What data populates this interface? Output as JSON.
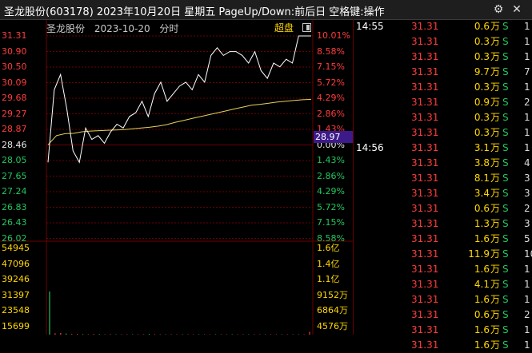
{
  "header": {
    "title": "圣龙股份(603178)  2023年10月20日  星期五  PageUp/Down:前后日  空格键:操作",
    "settings_icon": "gear-icon",
    "close_icon": "close-icon"
  },
  "chart": {
    "stock_name": "圣龙股份",
    "date_label": "2023-10-20",
    "period_label": "分时",
    "super_label": "超盘",
    "current_price_label": "28.97",
    "price_axis": [
      "31.31",
      "30.90",
      "30.50",
      "30.09",
      "29.68",
      "29.27",
      "28.87",
      "28.46",
      "28.05",
      "27.65",
      "27.24",
      "26.83",
      "26.43",
      "26.02"
    ],
    "pct_axis": [
      "10.01%",
      "8.58%",
      "7.15%",
      "5.72%",
      "4.29%",
      "2.86%",
      "1.43%",
      "0.00%",
      "1.43%",
      "2.86%",
      "4.29%",
      "5.72%",
      "7.15%",
      "8.58%"
    ],
    "volume_axis": [
      "54945",
      "47096",
      "39246",
      "31397",
      "23548",
      "15699"
    ],
    "amount_axis": [
      "1.6亿",
      "1.4亿",
      "1.1亿",
      "9152万",
      "6864万",
      "4576万"
    ],
    "colors": {
      "up": "#ff3b3b",
      "down": "#22c55e",
      "price_line": "#ffffff",
      "avg_line": "#e6d15a",
      "grid": "#6b0000"
    }
  },
  "ticks": {
    "rows": [
      {
        "time": "14:55",
        "price": "31.31",
        "vol": "0.6",
        "unit": "万",
        "side": "S",
        "extra": "1"
      },
      {
        "time": "",
        "price": "31.31",
        "vol": "0.3",
        "unit": "万",
        "side": "S",
        "extra": "1"
      },
      {
        "time": "",
        "price": "31.31",
        "vol": "0.3",
        "unit": "万",
        "side": "S",
        "extra": "1"
      },
      {
        "time": "",
        "price": "31.31",
        "vol": "9.7",
        "unit": "万",
        "side": "S",
        "extra": "7"
      },
      {
        "time": "",
        "price": "31.31",
        "vol": "0.3",
        "unit": "万",
        "side": "S",
        "extra": "1"
      },
      {
        "time": "",
        "price": "31.31",
        "vol": "0.9",
        "unit": "万",
        "side": "S",
        "extra": "2"
      },
      {
        "time": "",
        "price": "31.31",
        "vol": "0.3",
        "unit": "万",
        "side": "S",
        "extra": "1"
      },
      {
        "time": "",
        "price": "31.31",
        "vol": "0.3",
        "unit": "万",
        "side": "S",
        "extra": "1"
      },
      {
        "time": "14:56",
        "price": "31.31",
        "vol": "3.1",
        "unit": "万",
        "side": "S",
        "extra": "1"
      },
      {
        "time": "",
        "price": "31.31",
        "vol": "3.8",
        "unit": "万",
        "side": "S",
        "extra": "4"
      },
      {
        "time": "",
        "price": "31.31",
        "vol": "8.1",
        "unit": "万",
        "side": "S",
        "extra": "3"
      },
      {
        "time": "",
        "price": "31.31",
        "vol": "3.4",
        "unit": "万",
        "side": "S",
        "extra": "3"
      },
      {
        "time": "",
        "price": "31.31",
        "vol": "0.6",
        "unit": "万",
        "side": "S",
        "extra": "2"
      },
      {
        "time": "",
        "price": "31.31",
        "vol": "1.3",
        "unit": "万",
        "side": "S",
        "extra": "3"
      },
      {
        "time": "",
        "price": "31.31",
        "vol": "1.6",
        "unit": "万",
        "side": "S",
        "extra": "5"
      },
      {
        "time": "",
        "price": "31.31",
        "vol": "11.9",
        "unit": "万",
        "side": "S",
        "extra": "10"
      },
      {
        "time": "",
        "price": "31.31",
        "vol": "1.6",
        "unit": "万",
        "side": "S",
        "extra": "1"
      },
      {
        "time": "",
        "price": "31.31",
        "vol": "4.1",
        "unit": "万",
        "side": "S",
        "extra": "1"
      },
      {
        "time": "",
        "price": "31.31",
        "vol": "1.6",
        "unit": "万",
        "side": "S",
        "extra": "1"
      },
      {
        "time": "",
        "price": "31.31",
        "vol": "0.6",
        "unit": "万",
        "side": "S",
        "extra": "2"
      },
      {
        "time": "",
        "price": "31.31",
        "vol": "1.6",
        "unit": "万",
        "side": "S",
        "extra": "1"
      },
      {
        "time": "",
        "price": "31.31",
        "vol": "1.6",
        "unit": "万",
        "side": "S",
        "extra": "1"
      }
    ]
  },
  "chart_data": {
    "type": "line",
    "xlabel": "",
    "ylabel": "",
    "ylim": [
      26.02,
      31.31
    ],
    "series": [
      {
        "values": [
          28.0,
          29.9,
          30.3,
          29.4,
          28.3,
          28.0,
          28.9,
          28.6,
          28.7,
          28.5,
          28.8,
          29.0,
          28.9,
          29.2,
          29.3,
          29.6,
          29.2,
          29.8,
          30.1,
          29.6,
          29.8,
          30.0,
          30.1,
          29.9,
          30.3,
          30.1,
          30.8,
          31.0,
          30.8,
          30.9,
          30.9,
          30.8,
          30.6,
          30.9,
          30.4,
          30.2,
          30.6,
          30.5,
          30.7,
          30.6,
          31.31,
          31.31,
          31.31
        ]
      },
      {
        "values": [
          28.46,
          28.7,
          28.75,
          28.76,
          28.8,
          28.82,
          28.83,
          28.84,
          28.85,
          28.86,
          28.88,
          28.9,
          28.92,
          28.95,
          28.99,
          29.05,
          29.1,
          29.15,
          29.2,
          29.25,
          29.3,
          29.35,
          29.4,
          29.45,
          29.5,
          29.52,
          29.55,
          29.58,
          29.6,
          29.62,
          29.64,
          29.65
        ]
      }
    ],
    "volume": [
      31397,
      1000,
      1200,
      800,
      500,
      600,
      400,
      300,
      500,
      400,
      300,
      400,
      300,
      300,
      300,
      300,
      300,
      300,
      500,
      400,
      300,
      300,
      300,
      300,
      300,
      300,
      300,
      300,
      300,
      300,
      300,
      300,
      300,
      300,
      300,
      300,
      300,
      300,
      300,
      300,
      300,
      300,
      300,
      300,
      300,
      300,
      300,
      2000
    ]
  }
}
